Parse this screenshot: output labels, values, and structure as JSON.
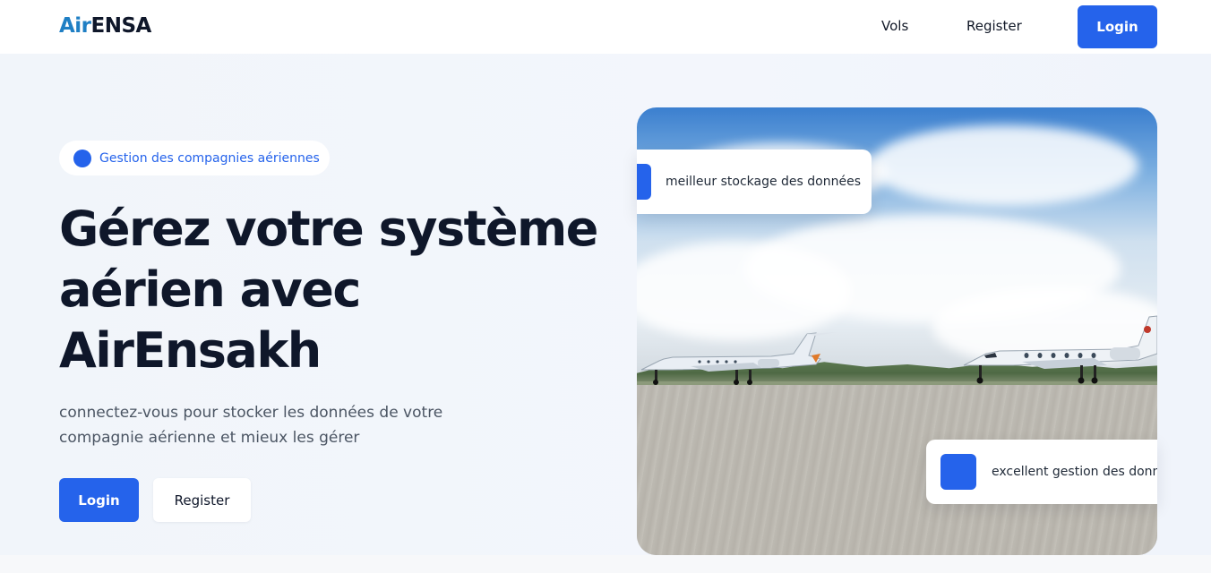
{
  "brand": {
    "part1": "Air",
    "part2": "ENSA"
  },
  "nav": {
    "vols": "Vols",
    "register": "Register",
    "login": "Login"
  },
  "hero": {
    "badge": "Gestion des compagnies aériennes",
    "headline": [
      "Gérez votre système",
      "aérien avec",
      "AirEnsakh"
    ],
    "subtext": "connectez-vous pour stocker les données de votre compagnie aérienne et mieux les gérer",
    "login_button": "Login",
    "register_button": "Register"
  },
  "image_cards": {
    "top": "meilleur stockage des données",
    "bottom": "excellent gestion des donnés"
  },
  "colors": {
    "accent": "#2563eb",
    "logo_air": "#1f7fc4",
    "text_dark": "#0f172a"
  }
}
